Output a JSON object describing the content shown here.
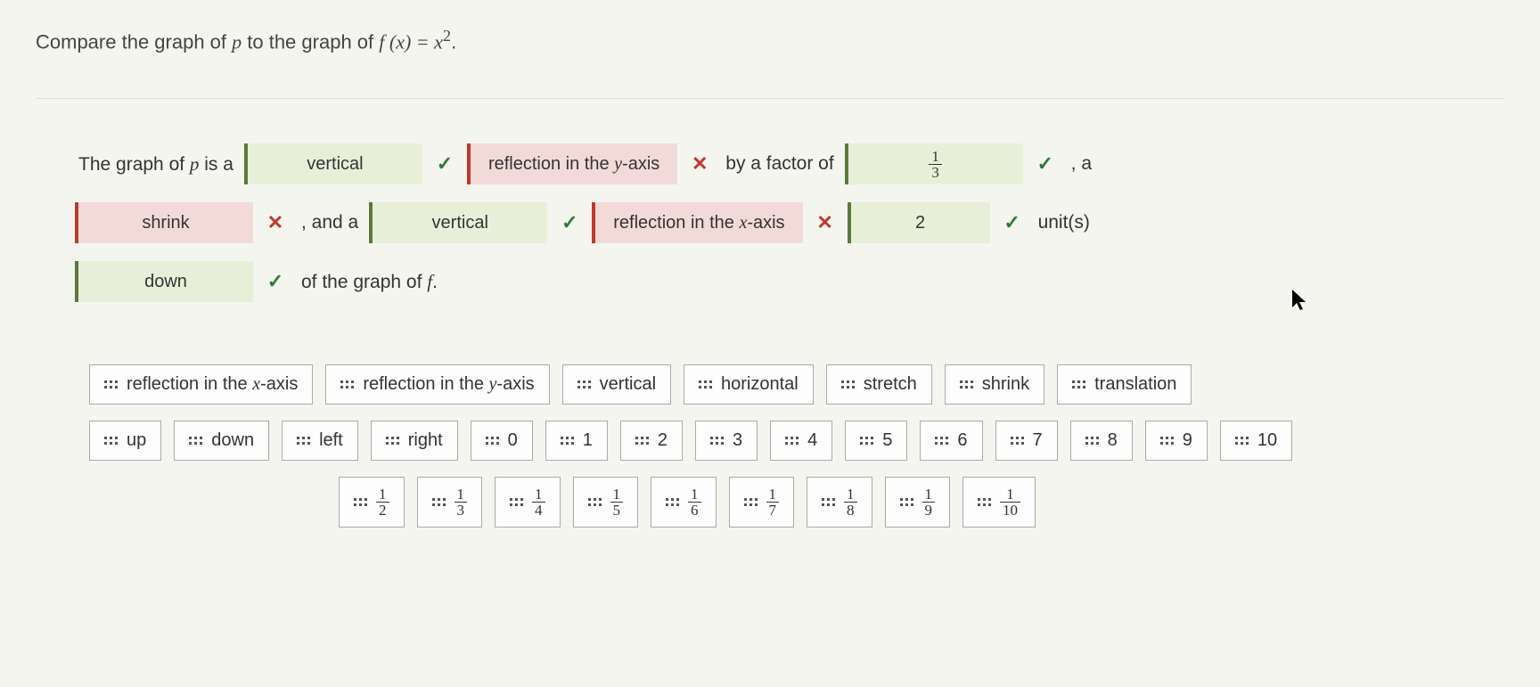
{
  "prompt": {
    "pre": "Compare the graph of ",
    "var_p": "p",
    "mid": " to the graph of ",
    "fn": "f (x) = x",
    "exp": "2",
    "post": "."
  },
  "sentence": {
    "s1": "The graph of ",
    "p": "p",
    "s2": " is a",
    "slot1": {
      "text": "vertical",
      "status": "correct"
    },
    "slot2": {
      "text": "reflection in the y-axis",
      "status": "incorrect",
      "var": "y"
    },
    "s3": "by a factor of",
    "slot3": {
      "num": "1",
      "den": "3",
      "status": "correct"
    },
    "s4": ", a",
    "slot4": {
      "text": "shrink",
      "status": "incorrect"
    },
    "s5": ", and a",
    "slot5": {
      "text": "vertical",
      "status": "correct"
    },
    "slot6": {
      "text": "reflection in the x-axis",
      "status": "incorrect",
      "var": "x"
    },
    "slot7": {
      "text": "2",
      "status": "correct"
    },
    "s6": "unit(s)",
    "slot8": {
      "text": "down",
      "status": "correct"
    },
    "s7": "of the graph of ",
    "f": "f",
    "s8": "."
  },
  "tiles": {
    "row1": [
      {
        "label": "reflection in the x-axis",
        "var": "x",
        "pre": "reflection in the ",
        "post": "-axis"
      },
      {
        "label": "reflection in the y-axis",
        "var": "y",
        "pre": "reflection in the ",
        "post": "-axis"
      },
      {
        "label": "vertical"
      },
      {
        "label": "horizontal"
      },
      {
        "label": "stretch"
      },
      {
        "label": "shrink"
      },
      {
        "label": "translation"
      }
    ],
    "row2": [
      {
        "label": "up"
      },
      {
        "label": "down"
      },
      {
        "label": "left"
      },
      {
        "label": "right"
      },
      {
        "label": "0"
      },
      {
        "label": "1"
      },
      {
        "label": "2"
      },
      {
        "label": "3"
      },
      {
        "label": "4"
      },
      {
        "label": "5"
      },
      {
        "label": "6"
      },
      {
        "label": "7"
      },
      {
        "label": "8"
      },
      {
        "label": "9"
      },
      {
        "label": "10"
      }
    ],
    "row3": [
      {
        "num": "1",
        "den": "2"
      },
      {
        "num": "1",
        "den": "3"
      },
      {
        "num": "1",
        "den": "4"
      },
      {
        "num": "1",
        "den": "5"
      },
      {
        "num": "1",
        "den": "6"
      },
      {
        "num": "1",
        "den": "7"
      },
      {
        "num": "1",
        "den": "8"
      },
      {
        "num": "1",
        "den": "9"
      },
      {
        "num": "1",
        "den": "10"
      }
    ]
  },
  "marks": {
    "correct": "✓",
    "incorrect": "✕"
  }
}
